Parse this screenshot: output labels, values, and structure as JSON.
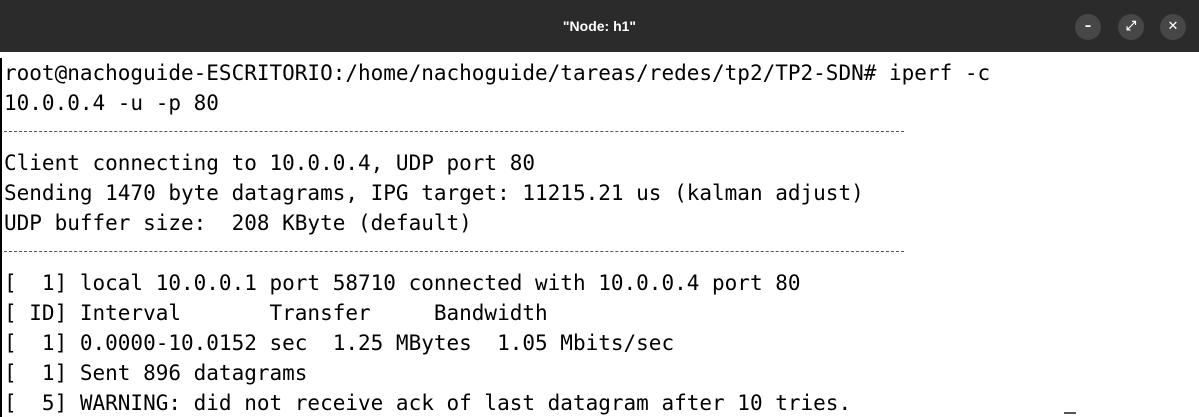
{
  "window": {
    "title": "\"Node: h1\"",
    "buttons": {
      "minimize": "–",
      "maximize": "⤢",
      "close": "✕"
    }
  },
  "terminal": {
    "lines": [
      "root@nachoguide-ESCRITORIO:/home/nachoguide/tareas/redes/tp2/TP2-SDN# iperf -c",
      "10.0.0.4 -u -p 80",
      "",
      "Client connecting to 10.0.0.4, UDP port 80",
      "Sending 1470 byte datagrams, IPG target: 11215.21 us (kalman adjust)",
      "UDP buffer size:  208 KByte (default)",
      "",
      "[  1] local 10.0.0.1 port 58710 connected with 10.0.0.4 port 80",
      "[ ID] Interval       Transfer     Bandwidth",
      "[  1] 0.0000-10.0152 sec  1.25 MBytes  1.05 Mbits/sec",
      "[  1] Sent 896 datagrams",
      "[  5] WARNING: did not receive ack of last datagram after 10 tries."
    ]
  },
  "colors": {
    "titlebar": "#2b2b2b",
    "button": "#474747",
    "terminal_bg": "#ffffff",
    "terminal_fg": "#000000"
  }
}
